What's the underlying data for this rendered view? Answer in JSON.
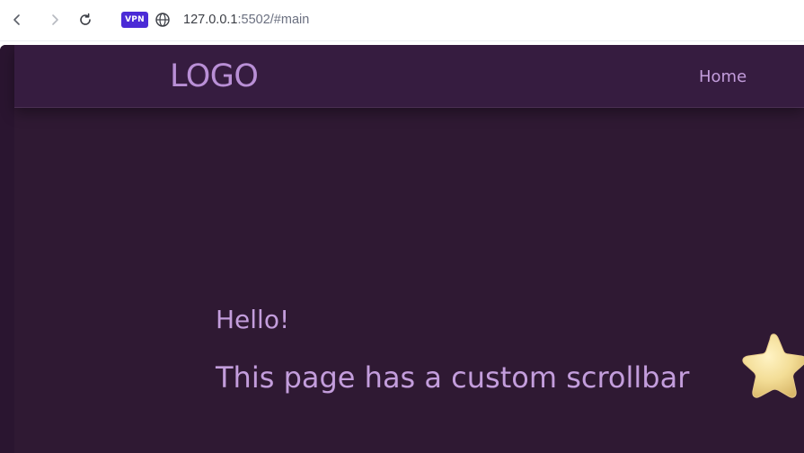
{
  "browser": {
    "vpn_label": "VPN",
    "url_host": "127.0.0.1",
    "url_path": ":5502/#main",
    "icons": {
      "back": "chevron-left-icon",
      "forward": "chevron-right-icon",
      "reload": "reload-icon",
      "site_info": "globe-icon"
    },
    "vpn_color": "#4b2bd6"
  },
  "header": {
    "logo": "LOGO",
    "nav_items": [
      "Home"
    ]
  },
  "hero": {
    "greeting": "Hello!",
    "subtitle": "This page has a custom scrollbar",
    "decoration": "star-icon"
  },
  "colors": {
    "page_background": "#2f1933",
    "header_background": "#361c40",
    "accent_text": "#c39ddc",
    "logo_text": "#b98fd6",
    "star_fill": "#f3dd96"
  }
}
